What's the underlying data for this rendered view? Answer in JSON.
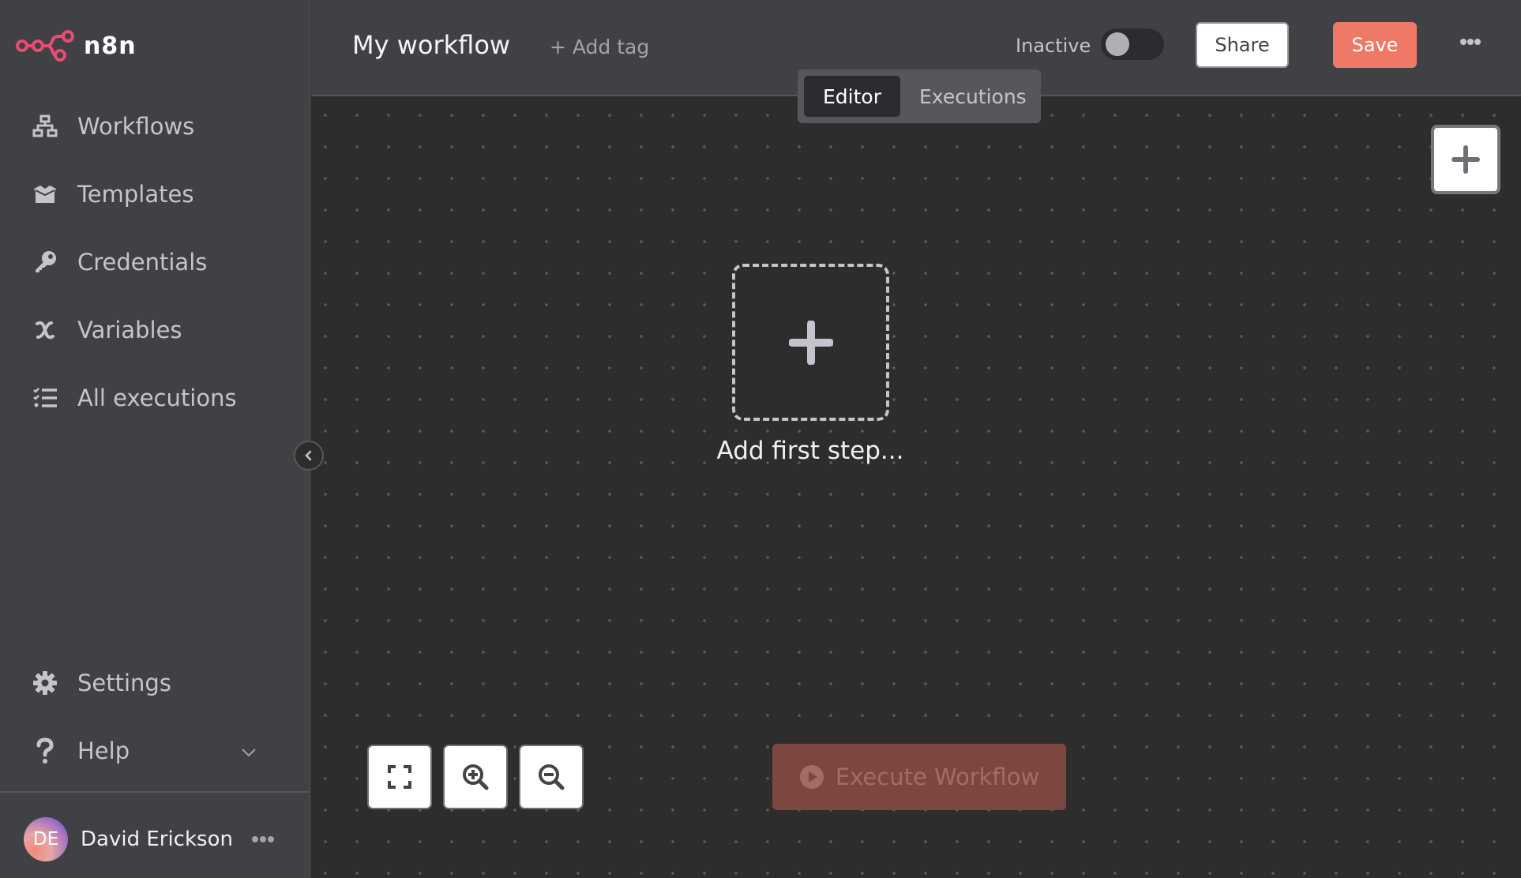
{
  "app": {
    "logo_text": "n8n",
    "brand_color": "#ea4b71",
    "accent_color": "#ee7966"
  },
  "sidebar": {
    "items": [
      {
        "label": "Workflows",
        "icon": "workflows-icon"
      },
      {
        "label": "Templates",
        "icon": "box-open-icon"
      },
      {
        "label": "Credentials",
        "icon": "key-icon"
      },
      {
        "label": "Variables",
        "icon": "variable-icon"
      },
      {
        "label": "All executions",
        "icon": "tasks-list-icon"
      }
    ],
    "bottom_items": [
      {
        "label": "Settings",
        "icon": "gear-icon"
      },
      {
        "label": "Help",
        "icon": "question-icon"
      }
    ],
    "user": {
      "initials": "DE",
      "name": "David Erickson"
    }
  },
  "header": {
    "workflow_name": "My workflow",
    "add_tag": "+ Add tag",
    "status_label": "Inactive",
    "active": false,
    "share_label": "Share",
    "save_label": "Save"
  },
  "tabs": [
    {
      "label": "Editor",
      "active": true
    },
    {
      "label": "Executions",
      "active": false
    }
  ],
  "canvas": {
    "first_step_label": "Add first step...",
    "execute_label": "Execute Workflow"
  }
}
